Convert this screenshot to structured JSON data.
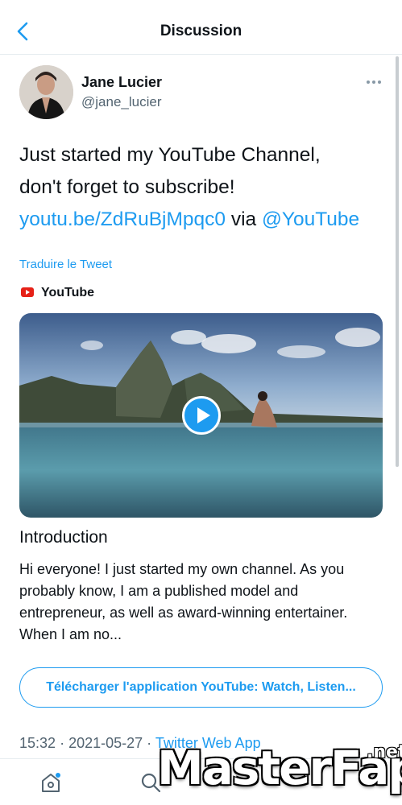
{
  "header": {
    "title": "Discussion",
    "back_icon": "chevron-left-icon"
  },
  "tweet": {
    "author": {
      "name": "Jane Lucier",
      "handle": "@jane_lucier"
    },
    "more_icon": "ellipsis-icon",
    "text_lines": [
      "Just started my YouTube Channel,",
      "don't forget to subscribe!"
    ],
    "link": "youtu.be/ZdRuBjMpqc0",
    "via": "via",
    "mention": "@YouTube",
    "translate": "Traduire le Tweet"
  },
  "card": {
    "source": "YouTube",
    "source_icon": "youtube-icon",
    "play_icon": "play-icon",
    "title": "Introduction",
    "description": "Hi everyone! I just started my own channel. As you probably know, I am a published model and entrepreneur, as well as award-winning entertainer. When I am no...",
    "download_label": "Télécharger l'application YouTube: Watch, Listen..."
  },
  "meta": {
    "time": "15:32",
    "date": "2021-05-27",
    "separator": "·",
    "app": "Twitter Web App"
  },
  "tabbar": {
    "home_icon": "home-icon",
    "search_icon": "search-icon"
  },
  "watermark": {
    "text": "MasterFap",
    "tld": ".net"
  },
  "colors": {
    "accent": "#1d9bf0",
    "text": "#0f1419",
    "secondary": "#536471",
    "youtube_red": "#e62117"
  }
}
